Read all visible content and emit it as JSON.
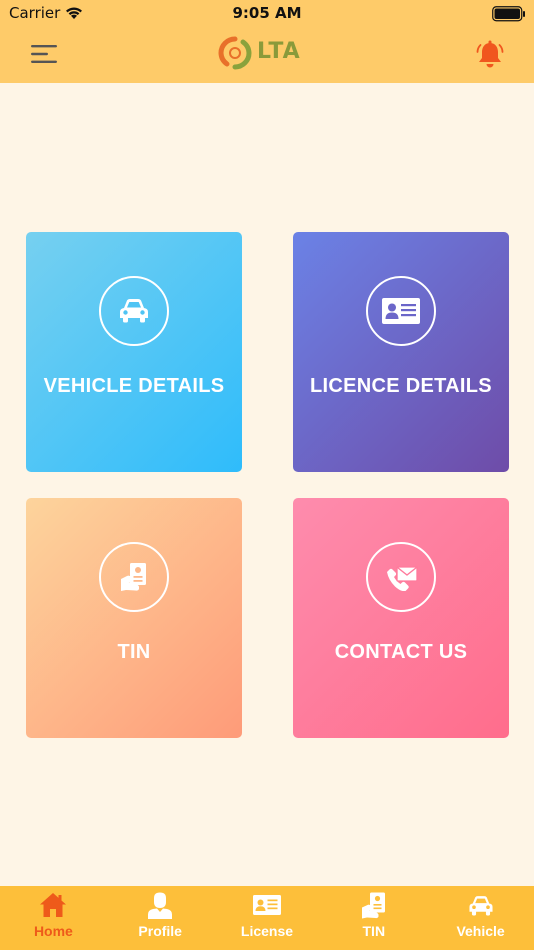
{
  "status": {
    "carrier": "Carrier",
    "time": "9:05 AM"
  },
  "header": {
    "logo_text": "LTA"
  },
  "tiles": [
    {
      "label": "VEHICLE DETAILS",
      "icon": "car-icon"
    },
    {
      "label": "LICENCE DETAILS",
      "icon": "id-card-icon"
    },
    {
      "label": "TIN",
      "icon": "hand-card-icon"
    },
    {
      "label": "CONTACT US",
      "icon": "phone-mail-icon"
    }
  ],
  "tabs": [
    {
      "label": "Home",
      "icon": "home-icon",
      "active": true
    },
    {
      "label": "Profile",
      "icon": "user-icon"
    },
    {
      "label": "License",
      "icon": "id-card-icon"
    },
    {
      "label": "TIN",
      "icon": "hand-card-icon"
    },
    {
      "label": "Vehicle",
      "icon": "car-icon"
    }
  ],
  "colors": {
    "header": "#fecb69",
    "background": "#fef5e6",
    "tabbar": "#fdbf3a",
    "active_tab": "#ee5a1a",
    "bell": "#f0561e"
  }
}
